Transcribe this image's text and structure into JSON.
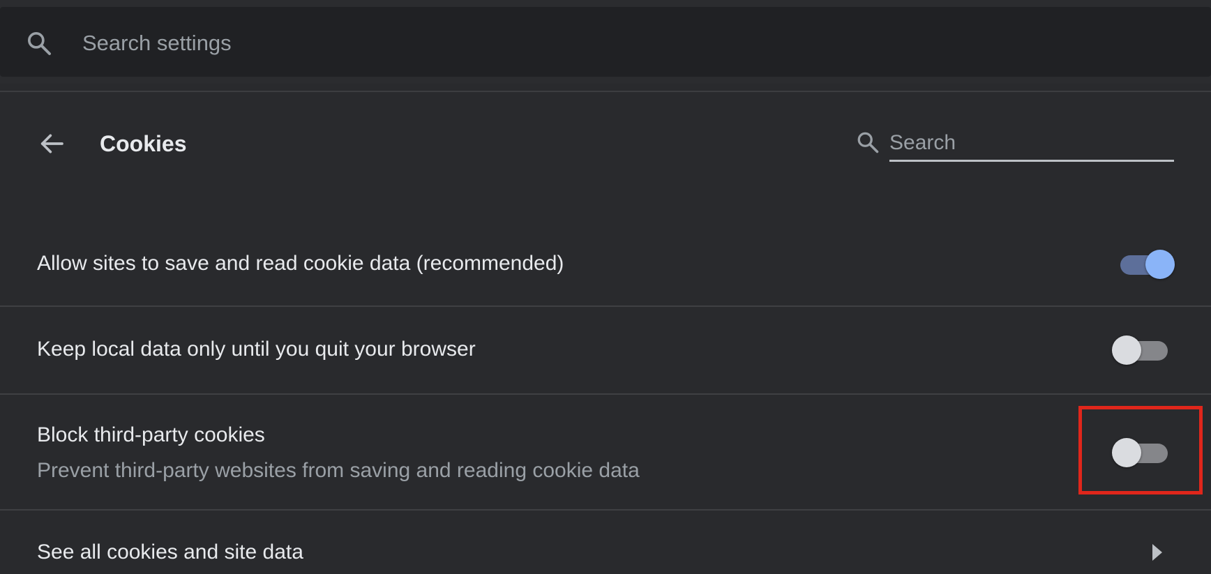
{
  "top_search": {
    "placeholder": "Search settings"
  },
  "header": {
    "title": "Cookies",
    "search_placeholder": "Search"
  },
  "rows": [
    {
      "label": "Allow sites to save and read cookie data (recommended)",
      "toggle": "on"
    },
    {
      "label": "Keep local data only until you quit your browser",
      "toggle": "off"
    },
    {
      "label": "Block third-party cookies",
      "sublabel": "Prevent third-party websites from saving and reading cookie data",
      "toggle": "off"
    },
    {
      "label": "See all cookies and site data"
    }
  ],
  "colors": {
    "background": "#292a2d",
    "toggle_on": "#8ab4f8",
    "highlight": "#e0261b"
  },
  "icons": [
    "search-icon",
    "back-arrow-icon",
    "search-icon",
    "chevron-right-icon"
  ]
}
